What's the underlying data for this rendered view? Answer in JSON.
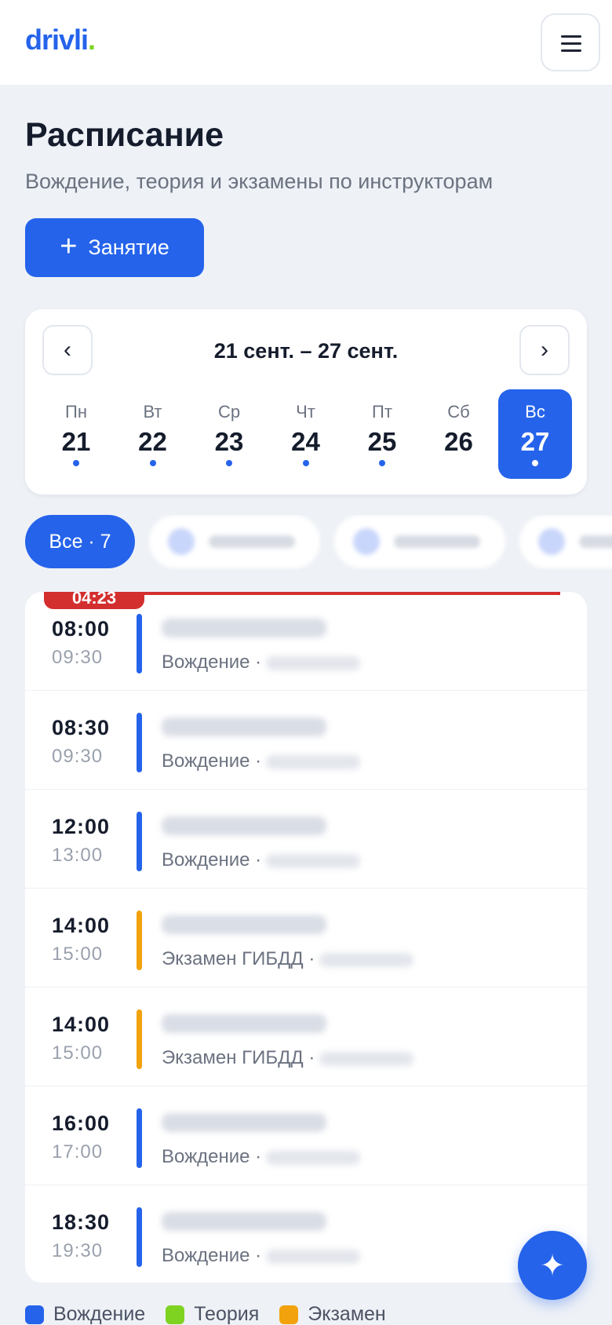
{
  "app": {
    "logo": "drivli",
    "logo_dot": "."
  },
  "page": {
    "title": "Расписание",
    "subtitle": "Вождение, теория и экзамены по инструкторам",
    "add_label": "Занятие"
  },
  "week": {
    "range": "21 сент. – 27 сент.",
    "days": [
      {
        "name": "Пн",
        "num": "21",
        "has_events": true
      },
      {
        "name": "Вт",
        "num": "22",
        "has_events": true
      },
      {
        "name": "Ср",
        "num": "23",
        "has_events": true
      },
      {
        "name": "Чт",
        "num": "24",
        "has_events": true
      },
      {
        "name": "Пт",
        "num": "25",
        "has_events": true
      },
      {
        "name": "Сб",
        "num": "26",
        "has_events": false
      },
      {
        "name": "Вс",
        "num": "27",
        "has_events": true,
        "active": true
      }
    ]
  },
  "filters": {
    "all_label": "Все · 7"
  },
  "now_time": "04:23",
  "events": [
    {
      "start": "08:00",
      "end": "09:30",
      "type": "Вождение ·",
      "color": "#2563eb"
    },
    {
      "start": "08:30",
      "end": "09:30",
      "type": "Вождение ·",
      "color": "#2563eb"
    },
    {
      "start": "12:00",
      "end": "13:00",
      "type": "Вождение ·",
      "color": "#2563eb"
    },
    {
      "start": "14:00",
      "end": "15:00",
      "type": "Экзамен ГИБДД ·",
      "color": "#f2a20c"
    },
    {
      "start": "14:00",
      "end": "15:00",
      "type": "Экзамен ГИБДД ·",
      "color": "#f2a20c"
    },
    {
      "start": "16:00",
      "end": "17:00",
      "type": "Вождение ·",
      "color": "#2563eb"
    },
    {
      "start": "18:30",
      "end": "19:30",
      "type": "Вождение ·",
      "color": "#2563eb"
    }
  ],
  "legend": [
    {
      "label": "Вождение",
      "color": "#2563eb"
    },
    {
      "label": "Теория",
      "color": "#7ed321"
    },
    {
      "label": "Экзамен",
      "color": "#f2a20c"
    }
  ],
  "icons": {
    "menu": "hamburger-icon",
    "prev": "chevron-left-icon",
    "next": "chevron-right-icon",
    "add": "plus-icon",
    "fab": "sparkle-icon"
  }
}
